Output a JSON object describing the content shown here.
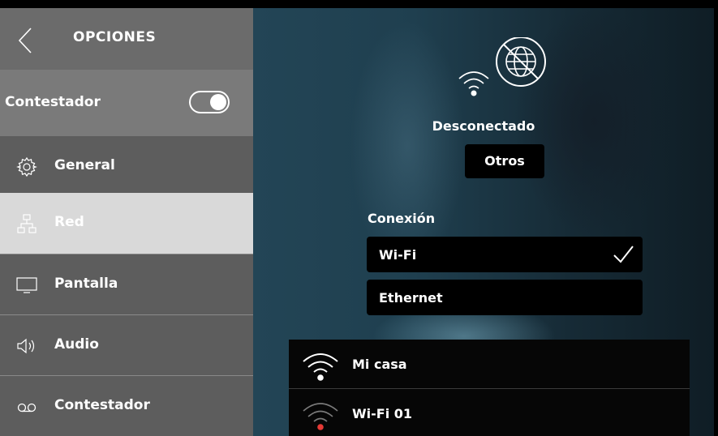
{
  "sidebar": {
    "title": "OPCIONES",
    "toggle": {
      "label": "Contestador",
      "on": true
    },
    "items": [
      {
        "label": "General",
        "icon": "gear-icon"
      },
      {
        "label": "Red",
        "icon": "network-icon",
        "active": true
      },
      {
        "label": "Pantalla",
        "icon": "monitor-icon"
      },
      {
        "label": "Audio",
        "icon": "speaker-icon"
      },
      {
        "label": "Contestador",
        "icon": "voicemail-icon"
      }
    ]
  },
  "main": {
    "status_icon": "wifi-no-internet-icon",
    "status_text": "Desconectado",
    "otros_label": "Otros",
    "connection_label": "Conexión",
    "options": [
      {
        "label": "Wi-Fi",
        "selected": true
      },
      {
        "label": "Ethernet",
        "selected": false
      }
    ],
    "networks": [
      {
        "name": "Mi casa",
        "signal_color": "#ffffff"
      },
      {
        "name": "Wi-Fi 01",
        "signal_color": "#e53935"
      }
    ]
  },
  "colors": {
    "sidebar_bg": "#6b6b6b",
    "active_item_bg": "#d9d9d9",
    "accent_red": "#e53935"
  }
}
